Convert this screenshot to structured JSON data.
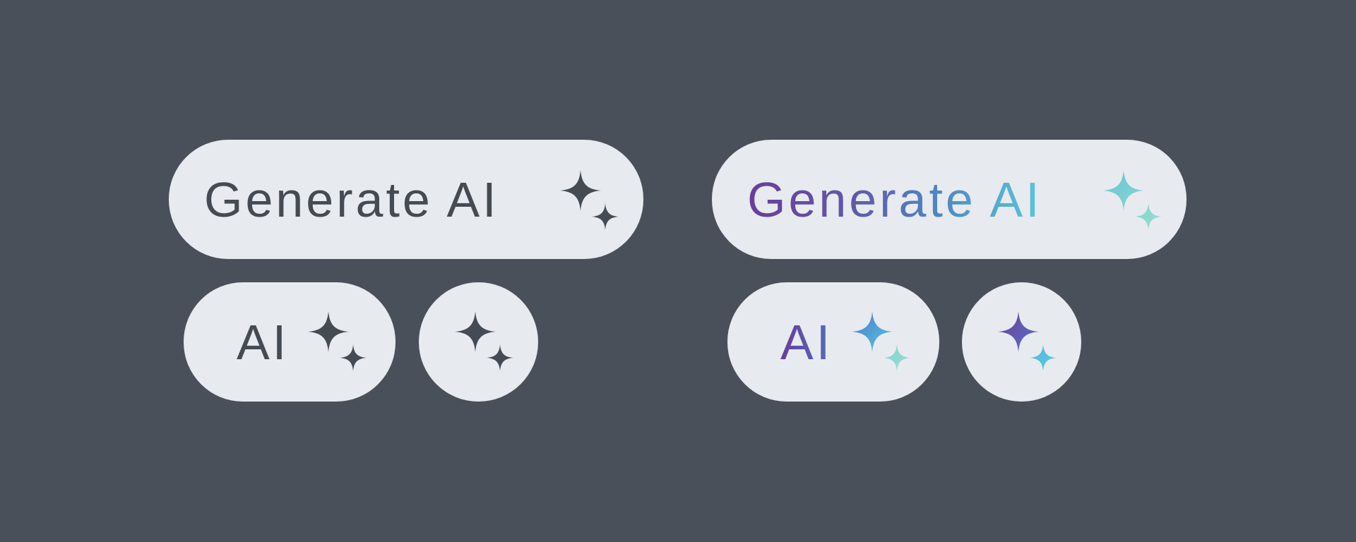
{
  "colors": {
    "background": "#4a5059",
    "button_fill": "#e7ebef",
    "dark_ink": "#454b53",
    "gradient": [
      "#6a3c9c",
      "#4f86c4",
      "#5ac7db"
    ]
  },
  "dark_set": {
    "generate_label": "Generate AI",
    "ai_label": "AI",
    "icon": "sparkles-icon"
  },
  "gradient_set": {
    "generate_label": "Generate AI",
    "ai_label": "AI",
    "icon": "sparkles-icon"
  }
}
